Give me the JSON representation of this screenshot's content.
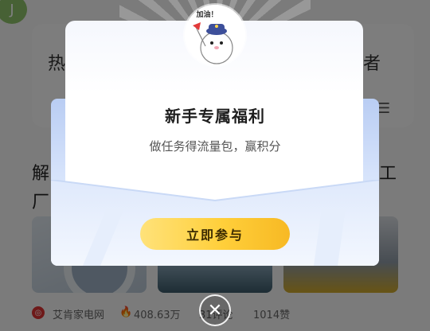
{
  "background": {
    "corner_icon": "J",
    "search_hint_left": "热",
    "search_hint_right": "者",
    "menu_icon": "☰",
    "headline_line1": "解",
    "headline_line1_end": "工",
    "headline_line2": "厂",
    "source_icon": "◎",
    "source_name": "艾肯家电网",
    "fire_icon": "🔥",
    "views": "408.63万",
    "comments": "31评论",
    "likes": "1014赞"
  },
  "modal": {
    "cheer_text": "加油！",
    "title": "新手专属福利",
    "subtitle": "做任务得流量包，赢积分",
    "cta_label": "立即参与",
    "close_icon": "✕",
    "colors": {
      "cta_start": "#ffe27a",
      "cta_end": "#f7b924",
      "envelope": "#b9cdf3"
    }
  }
}
